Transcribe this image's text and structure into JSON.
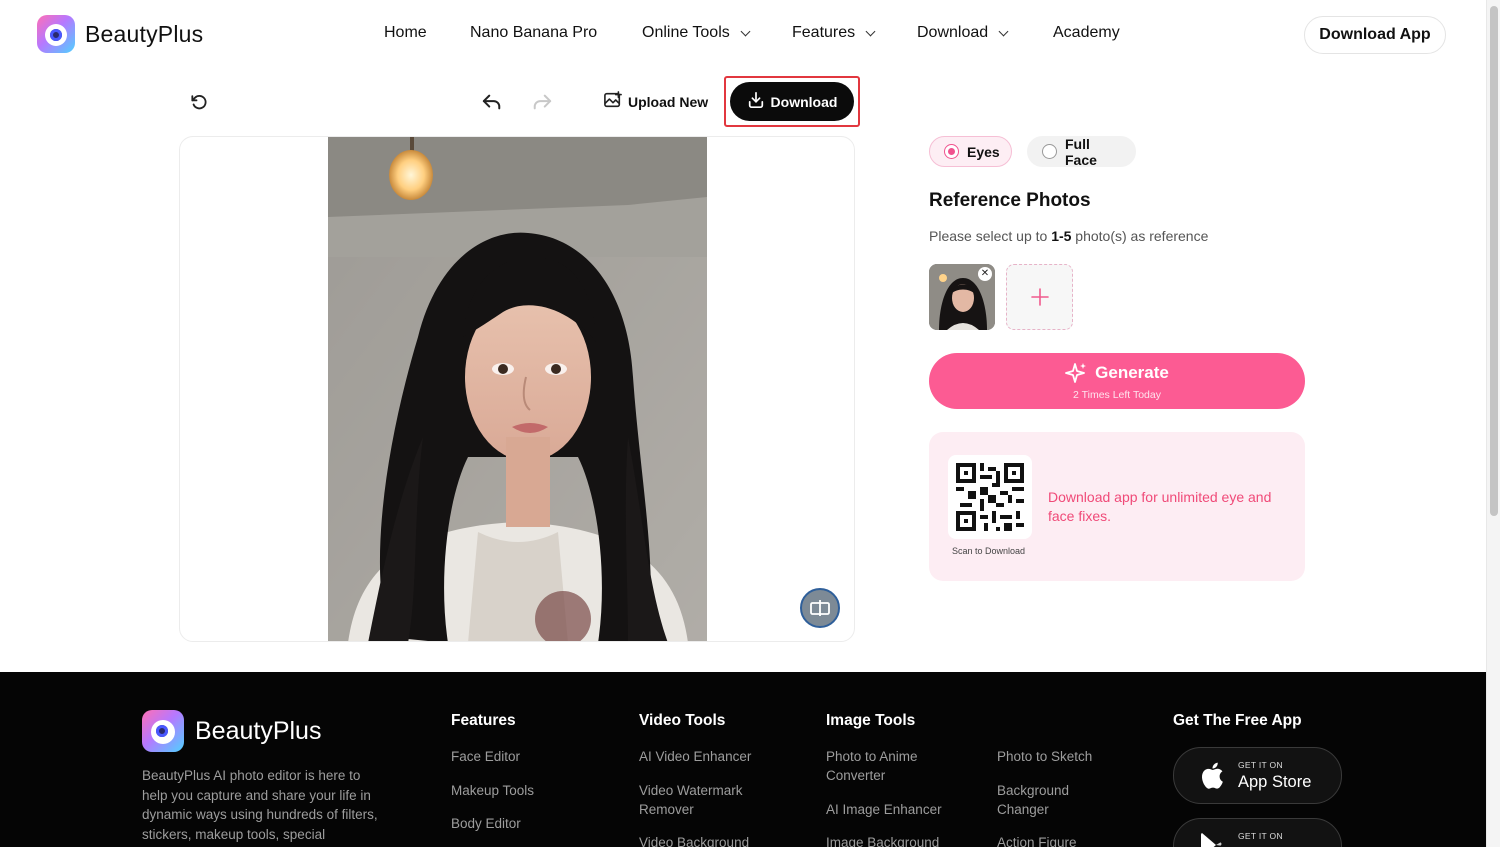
{
  "header": {
    "brand": "BeautyPlus",
    "nav": [
      {
        "label": "Home",
        "dropdown": false
      },
      {
        "label": "Nano Banana Pro",
        "dropdown": false
      },
      {
        "label": "Online Tools",
        "dropdown": true
      },
      {
        "label": "Features",
        "dropdown": true
      },
      {
        "label": "Download",
        "dropdown": true
      },
      {
        "label": "Academy",
        "dropdown": false
      }
    ],
    "cta": "Download App"
  },
  "toolbar": {
    "reset_icon": "rotate-ccw-icon",
    "undo_icon": "undo-icon",
    "redo_icon": "redo-icon",
    "upload_label": "Upload New",
    "download_label": "Download",
    "highlight_color": "#e2373f"
  },
  "editor": {
    "compare_icon": "compare-split-icon"
  },
  "panel": {
    "modes": [
      {
        "label": "Eyes",
        "selected": true
      },
      {
        "label": "Full Face",
        "selected": false
      }
    ],
    "ref_title": "Reference Photos",
    "ref_sub_prefix": "Please select up to ",
    "ref_sub_range": "1-5",
    "ref_sub_suffix": " photo(s) as reference",
    "remove_icon": "close-icon",
    "add_icon": "plus-icon",
    "generate_label": "Generate",
    "generate_sub": "2 Times Left Today",
    "accent": "#fc5b93",
    "promo_text": "Download app for unlimited eye and face fixes.",
    "qr_caption": "Scan to Download"
  },
  "footer": {
    "brand": "BeautyPlus",
    "description": "BeautyPlus AI photo editor is here to help you capture and share your life in dynamic ways using hundreds of filters, stickers, makeup tools, special",
    "features_title": "Features",
    "features": [
      "Face Editor",
      "Makeup Tools",
      "Body Editor"
    ],
    "video_title": "Video Tools",
    "video": [
      "AI Video Enhancer",
      "Video Watermark Remover",
      "Video Background"
    ],
    "image_title": "Image Tools",
    "image_col1": [
      "Photo to Anime Converter",
      "AI Image Enhancer",
      "Image Background"
    ],
    "image_col2": [
      "Photo to Sketch",
      "Background Changer",
      "Action Figure"
    ],
    "app_title": "Get The Free App",
    "appstore_small": "GET IT ON",
    "appstore_big": "App Store",
    "google_small": "GET IT ON"
  }
}
